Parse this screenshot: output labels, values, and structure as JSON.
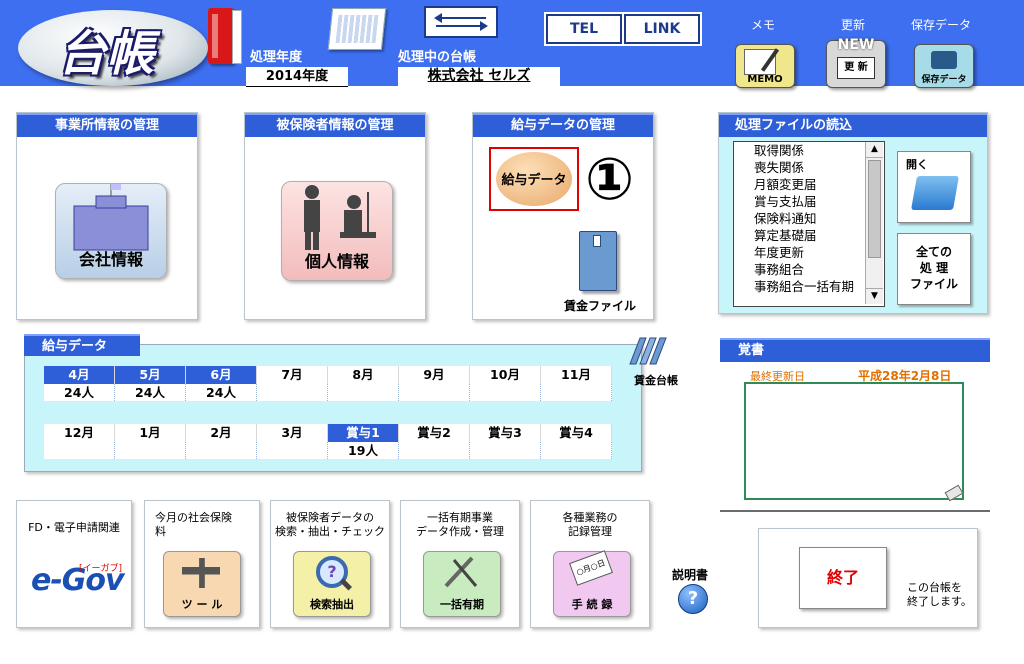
{
  "header": {
    "logo": "台帳",
    "year_label": "処理年度",
    "year_value": "2014年度",
    "company_label": "処理中の台帳",
    "company_value": "株式会社 セルズ",
    "tel_button": "TEL",
    "link_button": "LINK",
    "memo_label": "メモ",
    "memo_icon_text": "MEMO",
    "update_label": "更新",
    "update_icon_text": "NEW",
    "update_icon_sub": "更 新",
    "save_label": "保存データ",
    "save_icon_text": "保存データ"
  },
  "panels": {
    "office": {
      "title": "事業所情報の管理",
      "button": "会社情報"
    },
    "insured": {
      "title": "被保険者情報の管理",
      "button": "個人情報"
    },
    "salary": {
      "title": "給与データの管理",
      "button": "給与データ",
      "marker": "①",
      "file_button": "賃金ファイル"
    },
    "files": {
      "title": "処理ファイルの読込",
      "items": [
        "取得関係",
        "喪失関係",
        "月額変更届",
        "賞与支払届",
        "保険料通知",
        "算定基礎届",
        "年度更新",
        "事務組合",
        "事務組合一括有期"
      ],
      "open_button": "開く",
      "all_button_line1": "全ての",
      "all_button_line2": "処 理",
      "all_button_line3": "ファイル"
    }
  },
  "salary_data": {
    "title": "給与データ",
    "ledger_button": "賃金台帳",
    "row1": [
      {
        "m": "4月",
        "v": "24人",
        "active": true
      },
      {
        "m": "5月",
        "v": "24人",
        "active": true
      },
      {
        "m": "6月",
        "v": "24人",
        "active": true
      },
      {
        "m": "7月",
        "v": "",
        "active": false
      },
      {
        "m": "8月",
        "v": "",
        "active": false
      },
      {
        "m": "9月",
        "v": "",
        "active": false
      },
      {
        "m": "10月",
        "v": "",
        "active": false
      },
      {
        "m": "11月",
        "v": "",
        "active": false
      }
    ],
    "row2": [
      {
        "m": "12月",
        "v": "",
        "active": false
      },
      {
        "m": "1月",
        "v": "",
        "active": false
      },
      {
        "m": "2月",
        "v": "",
        "active": false
      },
      {
        "m": "3月",
        "v": "",
        "active": false
      },
      {
        "m": "賞与1",
        "v": "19人",
        "active": true
      },
      {
        "m": "賞与2",
        "v": "",
        "active": false
      },
      {
        "m": "賞与3",
        "v": "",
        "active": false
      },
      {
        "m": "賞与4",
        "v": "",
        "active": false
      }
    ]
  },
  "memo": {
    "title": "覚書",
    "updated_label": "最終更新日",
    "updated_value": "平成28年2月8日"
  },
  "tools": {
    "egov_caption": "FD・電子申請関連",
    "egov_logo": "e-Gov",
    "egov_sub": "[イーガブ]",
    "social_caption_1": "今月の社会保険",
    "social_caption_2": "料",
    "social_button": "ツ ー ル",
    "search_caption_1": "被保険者データの",
    "search_caption_2": "検索・抽出・チェック",
    "search_button": "検索抽出",
    "lump_caption_1": "一括有期事業",
    "lump_caption_2": "データ作成・管理",
    "lump_button": "一括有期",
    "record_caption_1": "各種業務の",
    "record_caption_2": "記録管理",
    "record_button": "手 続 録",
    "record_tag": "○月○日",
    "manual_label": "説明書",
    "manual_icon": "?",
    "exit_button": "終了",
    "exit_note_1": "この台帳を",
    "exit_note_2": "終了します。"
  },
  "colors": {
    "header_blue": "#3d6ff0",
    "title_blue": "#2f5fd8",
    "memo_border": "#2e8b57",
    "exit_red": "#e00000"
  }
}
